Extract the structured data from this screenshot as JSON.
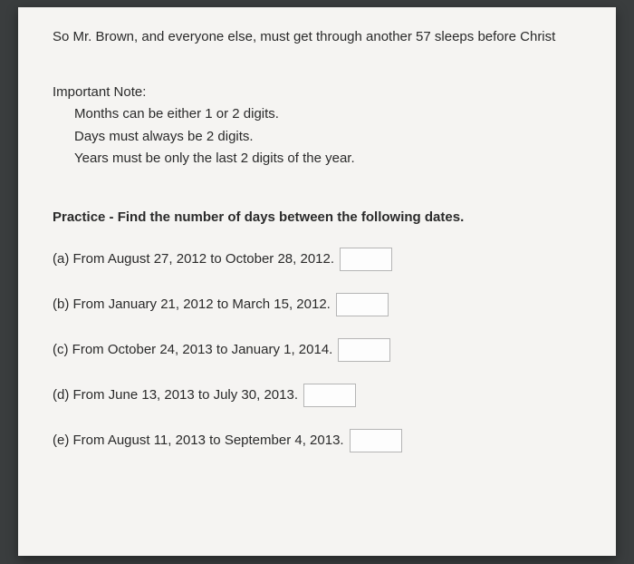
{
  "intro": "So Mr. Brown, and everyone else, must get through another 57 sleeps before Christ",
  "note": {
    "heading": "Important Note:",
    "items": [
      "Months can be either 1 or 2 digits.",
      "Days must always be 2 digits.",
      "Years must be only the last 2 digits of the year."
    ]
  },
  "practice_heading": "Practice - Find the number of days between the following dates.",
  "questions": [
    {
      "label": "(a) From August 27, 2012 to October 28, 2012."
    },
    {
      "label": "(b) From January 21, 2012 to March 15, 2012."
    },
    {
      "label": "(c) From October 24, 2013 to January 1, 2014."
    },
    {
      "label": "(d) From June 13, 2013 to July 30, 2013."
    },
    {
      "label": "(e) From August 11, 2013 to September 4, 2013."
    }
  ]
}
